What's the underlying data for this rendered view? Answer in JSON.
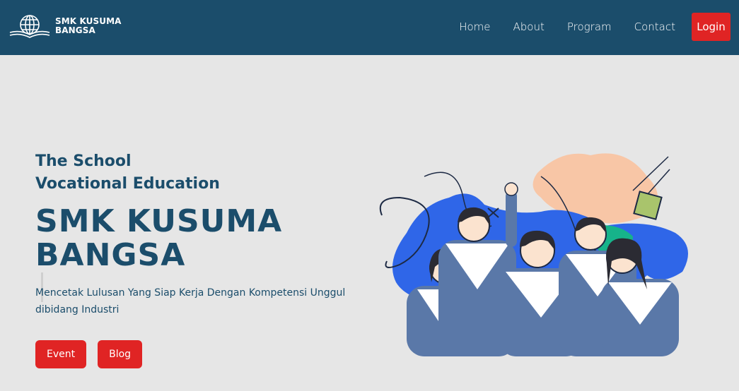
{
  "brand": {
    "line1": "SMK KUSUMA",
    "line2": "BANGSA",
    "logo_icon": "globe-book-icon"
  },
  "nav": {
    "items": [
      {
        "label": "Home"
      },
      {
        "label": "About"
      },
      {
        "label": "Program"
      },
      {
        "label": "Contact"
      }
    ],
    "login_label": "Login"
  },
  "hero": {
    "sub_line1": "The School",
    "sub_line2": "Vocational Education",
    "title_line1": "SMK KUSUMA",
    "title_line2": "BANGSA",
    "description": "Mencetak Lulusan Yang Siap Kerja Dengan Kompetensi Unggul dibidang Industri",
    "buttons": [
      {
        "label": "Event"
      },
      {
        "label": "Blog"
      }
    ]
  },
  "colors": {
    "navbar": "#1b4d6b",
    "accent": "#e02424",
    "background": "#e6e6e6",
    "illustration_blue": "#2f66e8",
    "illustration_peach": "#f8c6a6",
    "uniform_blue": "#5a78a8"
  }
}
